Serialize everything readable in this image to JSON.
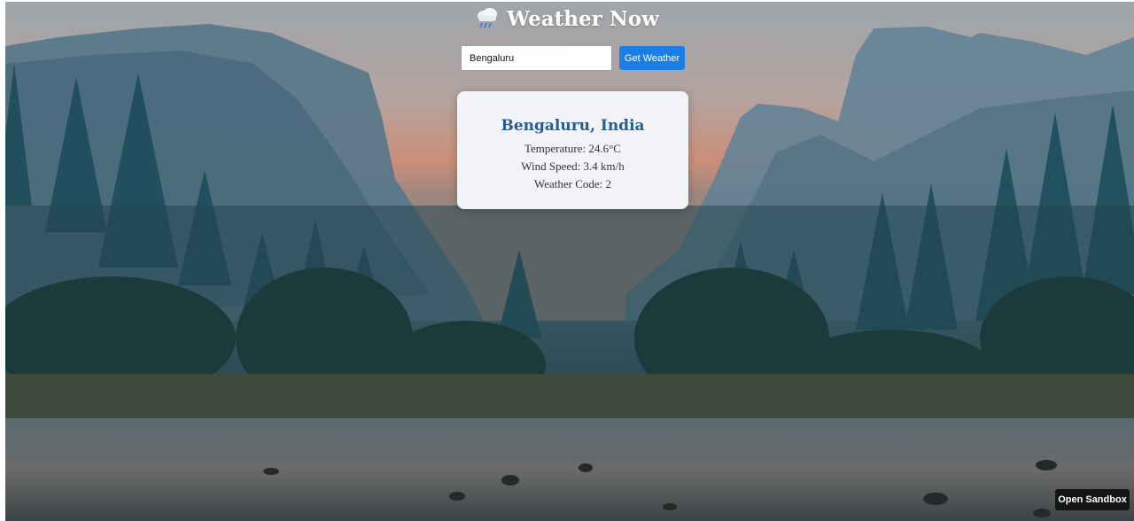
{
  "header": {
    "title": "Weather Now",
    "icon": "rain-cloud-icon"
  },
  "search": {
    "value": "Bengaluru",
    "button_label": "Get Weather"
  },
  "weather": {
    "city": "Bengaluru, India",
    "temperature": "Temperature: 24.6°C",
    "wind_speed": "Wind Speed: 3.4 km/h",
    "weather_code": "Weather Code: 2"
  },
  "footer": {
    "sandbox_label": "Open Sandbox"
  },
  "colors": {
    "accent": "#1a7ee6",
    "city_text": "#2a5d8f",
    "card_bg": "#f1f3f6",
    "sandbox_bg": "#151515"
  }
}
